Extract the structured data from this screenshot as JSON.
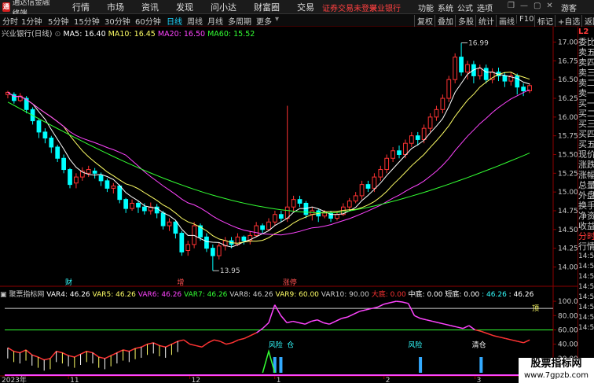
{
  "app": {
    "logo_text": "通达信金融终端"
  },
  "menu": [
    "行情",
    "市场",
    "资讯",
    "发现",
    "问小达",
    "财富圈",
    "交易"
  ],
  "header_links": {
    "login": "证券交易未登录",
    "stock": "兴业银行"
  },
  "right_menu": [
    "功能",
    "系统",
    "公式",
    "选项"
  ],
  "guest": "游客",
  "periods": [
    "分时",
    "1分钟",
    "5分钟",
    "15分钟",
    "30分钟",
    "60分钟",
    "日线",
    "周线",
    "月线",
    "多周期",
    "更多"
  ],
  "active_period": "日线",
  "tools": [
    "复权",
    "叠加",
    "多股",
    "统计",
    "画线",
    "F10",
    "标记",
    "+自选",
    "返回"
  ],
  "ma_legend": {
    "title": "兴业银行(日线)",
    "items": [
      {
        "label": "MA5: 16.40",
        "color": "#ffffff"
      },
      {
        "label": "MA10: 16.45",
        "color": "#ffff66"
      },
      {
        "label": "MA20: 16.50",
        "color": "#ff44ff"
      },
      {
        "label": "MA60: 15.52",
        "color": "#33ff33"
      }
    ]
  },
  "indicator_legend": {
    "title": "聚票指标网",
    "items": [
      {
        "label": "VAR4: 46.26",
        "color": "#ffffff"
      },
      {
        "label": "VAR5: 46.26",
        "color": "#ffff66"
      },
      {
        "label": "VAR6: 46.26",
        "color": "#ff44ff"
      },
      {
        "label": "VAR7: 46.26",
        "color": "#33ff33"
      },
      {
        "label": "VAR8: 46.26",
        "color": "#cccccc"
      },
      {
        "label": "VAR9: 60.00",
        "color": "#ffff66"
      },
      {
        "label": "VAR10: 90.00",
        "color": "#cccccc"
      },
      {
        "label": "大底: 0.00",
        "color": "#ff3333"
      },
      {
        "label": "中底: 0.00",
        "color": "#ffffff"
      },
      {
        "label": "短底: 0.00",
        "color": "#ffffff"
      },
      {
        "label": ": 46.26",
        "color": "#33ffff"
      },
      {
        "label": ": 46.26",
        "color": "#ffffff"
      },
      {
        "label": ": 46.26",
        "color": "#ffffff"
      },
      {
        "label": "粘合加速2: 0.00",
        "color": "#ffff66"
      },
      {
        "label": "加速",
        "color": "#3399ff"
      }
    ]
  },
  "price_axis": [
    "17.00",
    "16.75",
    "16.50",
    "16.25",
    "16.00",
    "15.75",
    "15.50",
    "15.25",
    "15.00",
    "14.75",
    "14.50",
    "14.25",
    "14.00"
  ],
  "ind_axis": [
    "100.00",
    "80.00",
    "60.00",
    "40.00",
    "20.00"
  ],
  "annotations": {
    "high_mark": "16.99",
    "low_mark": "13.95",
    "signals": [
      "财",
      "增",
      "涨停"
    ],
    "ind_signals": [
      "风险",
      "仓",
      "风险",
      "清仓",
      "顶"
    ],
    "year_label": "2023年",
    "month_labels": [
      "11",
      "12",
      "1",
      "2",
      "3"
    ]
  },
  "right_panel": [
    {
      "t": "委比",
      "c": "n"
    },
    {
      "t": "卖五",
      "c": "n"
    },
    {
      "t": "卖四",
      "c": "n"
    },
    {
      "t": "卖三",
      "c": "n"
    },
    {
      "t": "卖二",
      "c": "n"
    },
    {
      "t": "卖一",
      "c": "n"
    },
    {
      "t": "买一",
      "c": "n"
    },
    {
      "t": "买二",
      "c": "n"
    },
    {
      "t": "买三",
      "c": "n"
    },
    {
      "t": "买四",
      "c": "n"
    },
    {
      "t": "买五",
      "c": "n"
    },
    {
      "t": "现价",
      "c": "n"
    },
    {
      "t": "涨跌",
      "c": "n"
    },
    {
      "t": "涨幅",
      "c": "n"
    },
    {
      "t": "总量",
      "c": "n"
    },
    {
      "t": "外盘",
      "c": "n"
    },
    {
      "t": "换手",
      "c": "n"
    },
    {
      "t": "净资",
      "c": "n"
    },
    {
      "t": "收益",
      "c": "n"
    },
    {
      "t": "分时",
      "c": "r"
    },
    {
      "t": "行情",
      "c": "n"
    },
    {
      "t": "14:50",
      "c": "time"
    },
    {
      "t": "14:50",
      "c": "time"
    },
    {
      "t": "14:50",
      "c": "time"
    },
    {
      "t": "14:50",
      "c": "time"
    },
    {
      "t": "14:50",
      "c": "time"
    },
    {
      "t": "14:50",
      "c": "time"
    },
    {
      "t": "14:50",
      "c": "time"
    },
    {
      "t": "14:50",
      "c": "time"
    }
  ],
  "watermark": {
    "line1": "股票指标网",
    "line2": "www.7gpzb.com"
  },
  "colors": {
    "up": "#ff3333",
    "down": "#00ffff",
    "ma5": "#ffffff",
    "ma10": "#ffff66",
    "ma20": "#ff44ff",
    "ma60": "#33ff33",
    "axis": "#8b0000"
  },
  "chart_data": {
    "type": "candlestick",
    "ylim": [
      13.9,
      17.1
    ],
    "candles": [
      [
        16.3,
        16.33,
        16.25,
        16.35
      ],
      [
        16.3,
        16.22,
        16.18,
        16.33
      ],
      [
        16.22,
        16.28,
        16.2,
        16.32
      ],
      [
        16.25,
        16.1,
        16.05,
        16.28
      ],
      [
        16.1,
        15.95,
        15.9,
        16.13
      ],
      [
        15.95,
        15.8,
        15.72,
        15.98
      ],
      [
        15.8,
        15.72,
        15.65,
        15.85
      ],
      [
        15.72,
        15.6,
        15.52,
        15.75
      ],
      [
        15.6,
        15.45,
        15.4,
        15.63
      ],
      [
        15.45,
        15.3,
        15.25,
        15.5
      ],
      [
        15.3,
        15.1,
        15.05,
        15.32
      ],
      [
        15.12,
        15.2,
        15.05,
        15.25
      ],
      [
        15.2,
        15.28,
        15.15,
        15.33
      ],
      [
        15.25,
        15.3,
        15.2,
        15.35
      ],
      [
        15.28,
        15.25,
        15.18,
        15.32
      ],
      [
        15.22,
        15.15,
        15.08,
        15.26
      ],
      [
        15.15,
        15.05,
        15.0,
        15.18
      ],
      [
        15.05,
        15.08,
        14.98,
        15.12
      ],
      [
        15.08,
        14.9,
        14.85,
        15.1
      ],
      [
        14.9,
        14.78,
        14.72,
        14.92
      ],
      [
        14.78,
        14.85,
        14.75,
        14.9
      ],
      [
        14.85,
        14.8,
        14.72,
        14.88
      ],
      [
        14.8,
        14.75,
        14.7,
        14.85
      ],
      [
        14.75,
        14.8,
        14.7,
        14.86
      ],
      [
        14.8,
        14.72,
        14.65,
        14.84
      ],
      [
        14.72,
        14.55,
        14.5,
        14.75
      ],
      [
        14.55,
        14.6,
        14.48,
        14.65
      ],
      [
        14.6,
        14.45,
        14.38,
        14.62
      ],
      [
        14.45,
        14.2,
        14.15,
        14.48
      ],
      [
        14.22,
        14.3,
        14.15,
        14.35
      ],
      [
        14.3,
        14.55,
        14.25,
        14.6
      ],
      [
        14.55,
        14.4,
        14.35,
        14.58
      ],
      [
        14.4,
        14.25,
        14.2,
        14.45
      ],
      [
        14.25,
        14.15,
        13.95,
        14.3
      ],
      [
        14.15,
        14.28,
        14.1,
        14.32
      ],
      [
        14.28,
        14.35,
        14.22,
        14.4
      ],
      [
        14.35,
        14.3,
        14.25,
        14.4
      ],
      [
        14.3,
        14.4,
        14.28,
        14.45
      ],
      [
        14.4,
        14.35,
        14.3,
        14.42
      ],
      [
        14.35,
        14.42,
        14.3,
        14.48
      ],
      [
        14.42,
        14.55,
        14.4,
        14.6
      ],
      [
        14.55,
        14.5,
        14.45,
        14.58
      ],
      [
        14.5,
        14.6,
        14.48,
        14.65
      ],
      [
        14.6,
        14.7,
        14.55,
        14.75
      ],
      [
        14.7,
        14.65,
        14.6,
        14.75
      ],
      [
        14.65,
        14.8,
        14.6,
        16.15
      ],
      [
        14.8,
        14.9,
        14.75,
        14.95
      ],
      [
        14.9,
        14.85,
        14.8,
        14.95
      ],
      [
        14.85,
        14.7,
        14.65,
        14.88
      ],
      [
        14.7,
        14.75,
        14.62,
        14.8
      ],
      [
        14.75,
        14.68,
        14.6,
        14.78
      ],
      [
        14.68,
        14.72,
        14.65,
        14.76
      ],
      [
        14.72,
        14.65,
        14.6,
        14.75
      ],
      [
        14.65,
        14.7,
        14.62,
        14.74
      ],
      [
        14.7,
        14.8,
        14.68,
        14.85
      ],
      [
        14.8,
        14.88,
        14.75,
        14.92
      ],
      [
        14.88,
        14.95,
        14.85,
        15.0
      ],
      [
        14.95,
        15.1,
        14.9,
        15.15
      ],
      [
        15.1,
        15.05,
        15.0,
        15.15
      ],
      [
        15.05,
        15.2,
        15.0,
        15.25
      ],
      [
        15.2,
        15.3,
        15.15,
        15.35
      ],
      [
        15.3,
        15.45,
        15.25,
        15.5
      ],
      [
        15.45,
        15.55,
        15.4,
        15.6
      ],
      [
        15.55,
        15.5,
        15.45,
        15.62
      ],
      [
        15.5,
        15.65,
        15.45,
        15.7
      ],
      [
        15.65,
        15.75,
        15.6,
        15.8
      ],
      [
        15.75,
        15.7,
        15.62,
        15.8
      ],
      [
        15.7,
        15.85,
        15.65,
        15.9
      ],
      [
        15.85,
        16.0,
        15.8,
        16.05
      ],
      [
        16.0,
        16.1,
        15.95,
        16.15
      ],
      [
        16.1,
        16.25,
        16.05,
        16.3
      ],
      [
        16.25,
        16.5,
        16.2,
        16.55
      ],
      [
        16.5,
        16.8,
        16.45,
        16.85
      ],
      [
        16.8,
        16.6,
        16.55,
        16.99
      ],
      [
        16.6,
        16.7,
        16.5,
        16.75
      ],
      [
        16.7,
        16.55,
        16.45,
        16.75
      ],
      [
        16.55,
        16.65,
        16.5,
        16.7
      ],
      [
        16.65,
        16.5,
        16.45,
        16.7
      ],
      [
        16.5,
        16.6,
        16.45,
        16.65
      ],
      [
        16.6,
        16.55,
        16.48,
        16.66
      ],
      [
        16.55,
        16.48,
        16.4,
        16.6
      ],
      [
        16.48,
        16.55,
        16.42,
        16.6
      ],
      [
        16.55,
        16.4,
        16.3,
        16.58
      ],
      [
        16.4,
        16.35,
        16.28,
        16.45
      ],
      [
        16.35,
        16.42,
        16.32,
        16.45
      ]
    ],
    "ma60_start": 16.2,
    "ma60_end": 15.52,
    "ind_ylim": [
      0,
      110
    ],
    "indicator": [
      35,
      30,
      28,
      32,
      25,
      22,
      18,
      20,
      30,
      28,
      24,
      22,
      26,
      30,
      28,
      22,
      20,
      24,
      28,
      32,
      30,
      34,
      36,
      40,
      42,
      38,
      36,
      40,
      44,
      46,
      40,
      38,
      36,
      42,
      46,
      44,
      40,
      42,
      46,
      48,
      52,
      56,
      62,
      70,
      95,
      80,
      70,
      72,
      70,
      68,
      72,
      74,
      70,
      68,
      72,
      76,
      78,
      82,
      86,
      88,
      90,
      92,
      96,
      98,
      100,
      99,
      97,
      80,
      76,
      74,
      72,
      70,
      68,
      66,
      64,
      62,
      66,
      60,
      58,
      55,
      52,
      50,
      48,
      46,
      44,
      42,
      46
    ]
  }
}
